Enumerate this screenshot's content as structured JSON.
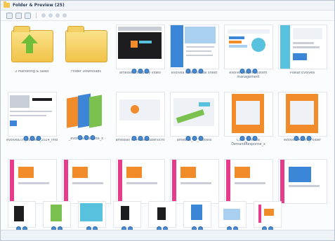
{
  "window": {
    "title": "Folder & Preview (25)"
  },
  "toolbar": {
    "icons": [
      "view-icon",
      "grid-icon",
      "list-icon",
      "zoom-icon",
      "rotate-icon",
      "prev-icon",
      "next-icon"
    ]
  },
  "items": [
    {
      "caption": "2 Marketing & Sales",
      "kind": "folder-up"
    },
    {
      "caption": "Folder Downloads",
      "kind": "folder"
    },
    {
      "caption": "amedias company video",
      "kind": "video"
    },
    {
      "caption": "evolvea case manual sheet",
      "kind": "doc-blue"
    },
    {
      "caption": "evolvea admin system management",
      "kind": "doc-chart"
    },
    {
      "caption": "Plakat Evolvea",
      "kind": "poster"
    },
    {
      "caption": "",
      "kind": "doc-dark"
    },
    {
      "caption": "",
      "kind": "brochure"
    },
    {
      "caption": "",
      "kind": "doc-light"
    },
    {
      "caption": "amedias_VP_Process",
      "kind": "doc-green"
    },
    {
      "caption": "Case_evolvea DemandResponse_x",
      "kind": "doc-orange"
    },
    {
      "caption": "evolvea Admin_Folder",
      "kind": "doc-orange"
    },
    {
      "caption": "",
      "kind": "page-pink"
    },
    {
      "caption": "",
      "kind": "page-pink"
    },
    {
      "caption": "",
      "kind": "page-pink"
    },
    {
      "caption": "",
      "kind": "page-pink"
    },
    {
      "caption": "",
      "kind": "page-pink"
    },
    {
      "caption": "",
      "kind": "page-blue"
    }
  ],
  "captions_row2": [
    "evolvea.ch_evolvea_2024_Info",
    "_evolvea Produkte_x",
    "amedias VP Prozessübersicht"
  ],
  "bottom_items_count": 8,
  "colors": {
    "accent": "#3b86d6",
    "folder": "#f3c64f",
    "arrow": "#6fbe3a",
    "pink": "#e73c8c"
  }
}
